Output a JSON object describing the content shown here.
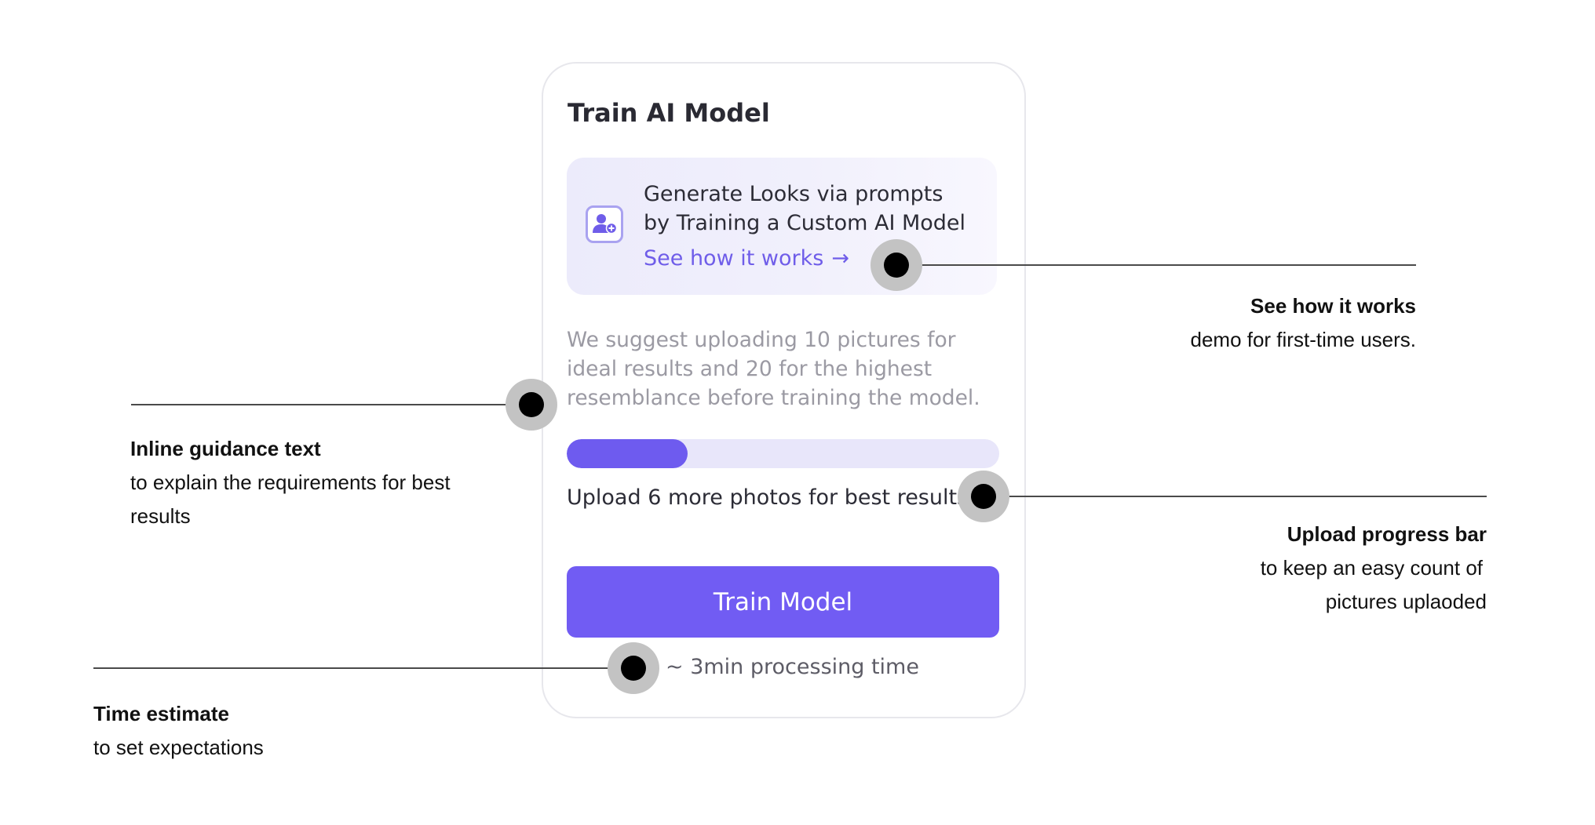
{
  "card": {
    "title": "Train AI Model",
    "promo": {
      "icon": "user-plus-icon",
      "text": "Generate Looks via prompts by Training a Custom AI Model",
      "link_label": "See how it works",
      "link_arrow": "→"
    },
    "guidance_text": "We suggest uploading 10 pictures for ideal results and 20 for the highest resemblance before training the model.",
    "progress": {
      "fraction": 0.28,
      "message": "Upload 6 more photos for best results!"
    },
    "train_button_label": "Train Model",
    "time_estimate": "~ 3min processing time"
  },
  "annotations": {
    "see_how": {
      "title": "See how it works",
      "text": "demo for first-time users."
    },
    "guidance": {
      "title": "Inline guidance text",
      "text": "to explain the requirements for best results"
    },
    "progress": {
      "title": "Upload progress bar",
      "text_line1": "to keep an easy count of",
      "text_line2": "pictures uplaoded"
    },
    "time": {
      "title": "Time estimate",
      "text": "to set expectations"
    }
  },
  "colors": {
    "accent": "#715cf3",
    "link": "#6f5de9",
    "progress_track": "#e8e6fa",
    "marker_halo": "#c3c3c3"
  }
}
